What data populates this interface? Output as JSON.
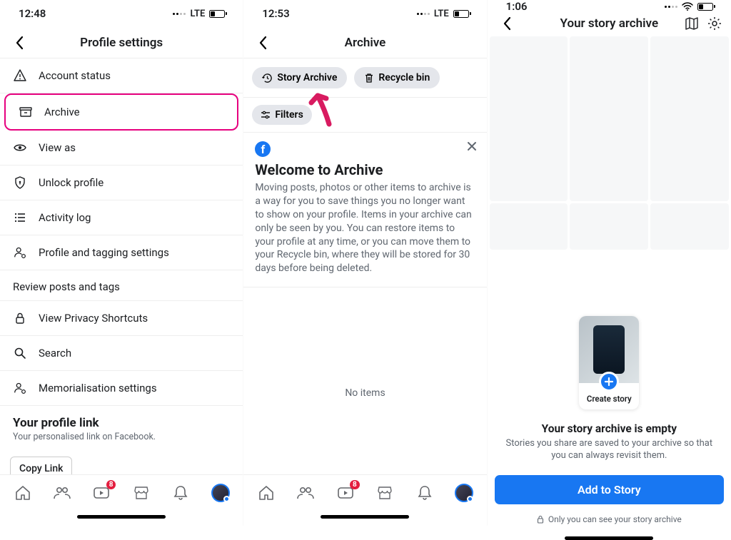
{
  "screens": [
    {
      "time": "12:48",
      "network": "LTE",
      "header": "Profile settings",
      "menu": [
        {
          "id": "account-status",
          "label": "Account status"
        },
        {
          "id": "archive",
          "label": "Archive",
          "highlighted": true
        },
        {
          "id": "view-as",
          "label": "View as"
        },
        {
          "id": "unlock-profile",
          "label": "Unlock profile"
        },
        {
          "id": "activity-log",
          "label": "Activity log"
        },
        {
          "id": "profile-tagging",
          "label": "Profile and tagging settings"
        }
      ],
      "section_head": "Review posts and tags",
      "menu2": [
        {
          "id": "privacy-shortcuts",
          "label": "View Privacy Shortcuts"
        },
        {
          "id": "search",
          "label": "Search"
        },
        {
          "id": "memorialisation",
          "label": "Memorialisation settings"
        }
      ],
      "profile_link_title": "Your profile link",
      "profile_link_sub": "Your personalised link on Facebook.",
      "copy_link": "Copy Link",
      "tab_badge": "8"
    },
    {
      "time": "12:53",
      "network": "LTE",
      "header": "Archive",
      "pills": {
        "story_archive": "Story Archive",
        "recycle_bin": "Recycle bin"
      },
      "filters": "Filters",
      "welcome_title": "Welcome to Archive",
      "welcome_body": "Moving posts, photos or other items to archive is a way for you to save things you no longer want to show on your profile. Items in your archive can only be seen by you. You can restore items to your profile at any time, or you can move them to your Recycle bin, where they will be stored for 30 days before being deleted.",
      "no_items": "No items",
      "tab_badge": "8"
    },
    {
      "time": "1:06",
      "header": "Your story archive",
      "create_story": "Create story",
      "empty_title": "Your story archive is empty",
      "empty_sub": "Stories you share are saved to your archive so that you can always revisit them.",
      "add_to_story": "Add to Story",
      "private_note": "Only you can see your story archive"
    }
  ]
}
